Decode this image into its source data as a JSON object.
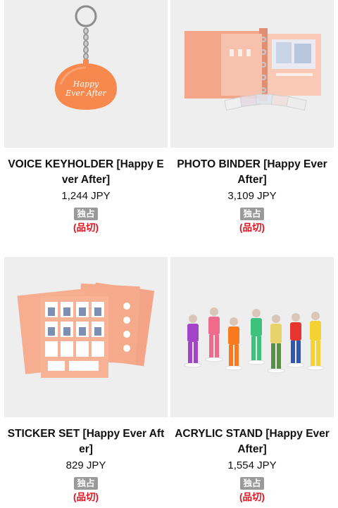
{
  "products": [
    {
      "image_label": "Happy Ever After",
      "title": "VOICE KEYHOLDER [Happy Ever After]",
      "price": "1,244 JPY",
      "badge": "独占",
      "status": "(品切)"
    },
    {
      "image_label": "",
      "title": "PHOTO BINDER [Happy Ever After]",
      "price": "3,109 JPY",
      "badge": "独占",
      "status": "(品切)"
    },
    {
      "image_label": "",
      "title": "STICKER SET [Happy Ever After]",
      "price": "829 JPY",
      "badge": "独占",
      "status": "(品切)"
    },
    {
      "image_label": "",
      "title": "ACRYLIC STAND [Happy Ever After]",
      "price": "1,554 JPY",
      "badge": "独占",
      "status": "(品切)"
    }
  ],
  "colors": {
    "peach": "#f6a98a",
    "orange": "#f7894e",
    "badge_gray": "#9a9a9a",
    "sold_out_red": "#e0141e",
    "thumb_bg": "#eeeeee"
  }
}
